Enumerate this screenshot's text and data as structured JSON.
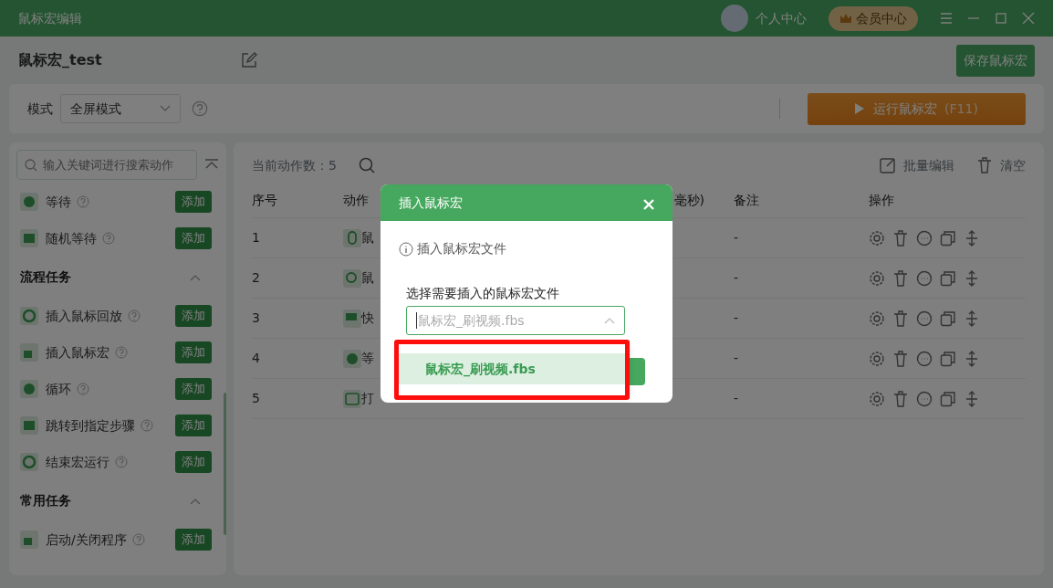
{
  "window": {
    "title": "鼠标宏编辑"
  },
  "header": {
    "user": "个人中心",
    "vip": "会员中心"
  },
  "macro": {
    "name": "鼠标宏_test",
    "save": "保存鼠标宏"
  },
  "mode": {
    "label": "模式",
    "value": "全屏模式",
    "run": "运行鼠标宏",
    "run_key": "(F11)"
  },
  "sidebar": {
    "search_placeholder": "输入关键词进行搜索动作",
    "groups": [
      {
        "items": [
          {
            "label": "等待",
            "add": "添加"
          },
          {
            "label": "随机等待",
            "add": "添加"
          }
        ]
      },
      {
        "title": "流程任务",
        "expanded": true,
        "items": [
          {
            "label": "插入鼠标回放",
            "add": "添加"
          },
          {
            "label": "插入鼠标宏",
            "add": "添加"
          },
          {
            "label": "循环",
            "add": "添加"
          },
          {
            "label": "跳转到指定步骤",
            "add": "添加"
          },
          {
            "label": "结束宏运行",
            "add": "添加"
          }
        ]
      },
      {
        "title": "常用任务",
        "expanded": true,
        "items": [
          {
            "label": "启动/关闭程序",
            "add": "添加"
          }
        ]
      }
    ]
  },
  "table": {
    "count": "当前动作数：5",
    "tools": [
      "批量编辑",
      "清空"
    ],
    "columns": [
      "序号",
      "动作",
      "毫秒)",
      "备注",
      "操作"
    ],
    "rows": [
      {
        "index": "1",
        "action": "鼠",
        "note": "-"
      },
      {
        "index": "2",
        "action": "鼠",
        "note": "-"
      },
      {
        "index": "3",
        "action": "快",
        "note": "-"
      },
      {
        "index": "4",
        "action": "等",
        "note": "-"
      },
      {
        "index": "5",
        "action": "打",
        "note": "-"
      }
    ]
  },
  "dialog": {
    "title": "插入鼠标宏",
    "info": "插入鼠标宏文件",
    "label": "选择需要插入的鼠标宏文件",
    "placeholder": "鼠标宏_刷视频.fbs",
    "expanded": true,
    "options": [
      {
        "label": "鼠标宏_刷视频.fbs",
        "selected": true
      }
    ]
  }
}
